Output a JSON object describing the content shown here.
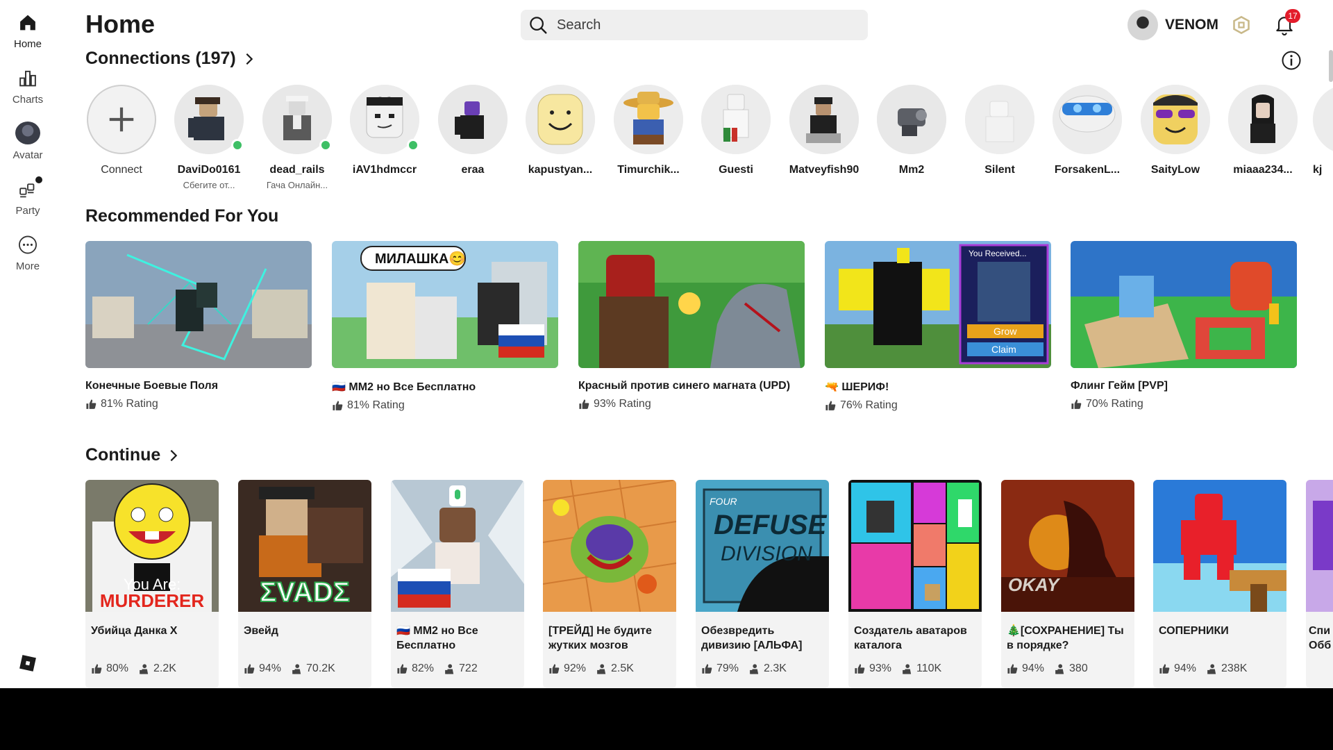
{
  "sidebar": {
    "items": [
      {
        "label": "Home",
        "icon": "home-icon"
      },
      {
        "label": "Charts",
        "icon": "charts-icon"
      },
      {
        "label": "Avatar",
        "icon": "avatar-icon"
      },
      {
        "label": "Party",
        "icon": "party-icon"
      },
      {
        "label": "More",
        "icon": "more-icon"
      }
    ]
  },
  "header": {
    "title": "Home",
    "search_placeholder": "Search",
    "username": "VENOM",
    "notification_count": "17"
  },
  "connections": {
    "title": "Connections (197)",
    "connect_label": "Connect",
    "friends": [
      {
        "name": "DaviDo0161",
        "status": "Сбегите от...",
        "online": true
      },
      {
        "name": "dead_rails",
        "status": "Гача Онлайн...",
        "online": true
      },
      {
        "name": "iAV1hdmccr",
        "status": "",
        "online": true
      },
      {
        "name": "eraa",
        "status": "",
        "online": false
      },
      {
        "name": "kapustyan...",
        "status": "",
        "online": false
      },
      {
        "name": "Timurchik...",
        "status": "",
        "online": false
      },
      {
        "name": "Guesti",
        "status": "",
        "online": false
      },
      {
        "name": "Matveyfish90",
        "status": "",
        "online": false
      },
      {
        "name": "Mm2",
        "status": "",
        "online": false
      },
      {
        "name": "Silent",
        "status": "",
        "online": false
      },
      {
        "name": "ForsakenL...",
        "status": "",
        "online": false
      },
      {
        "name": "SaityLow",
        "status": "",
        "online": false
      },
      {
        "name": "miaaa234...",
        "status": "",
        "online": false
      },
      {
        "name": "kj",
        "status": "",
        "online": false
      }
    ]
  },
  "recommended": {
    "title": "Recommended For You",
    "games": [
      {
        "title": "Конечные Боевые Поля",
        "rating": "81% Rating"
      },
      {
        "title": "🇷🇺 MM2 но Все Бесплатно",
        "rating": "81% Rating"
      },
      {
        "title": "Красный против синего магната (UPD)",
        "rating": "93% Rating"
      },
      {
        "title": "🔫 ШЕРИФ!",
        "rating": "76% Rating"
      },
      {
        "title": "Флинг Гейм [PVP]",
        "rating": "70% Rating"
      }
    ],
    "thumb_texts": {
      "milashka": "МИЛАШКА😊",
      "you_received": "You Received...",
      "grow": "Grow",
      "claim": "Claim"
    }
  },
  "continue": {
    "title": "Continue",
    "games": [
      {
        "title": "Убийца Данка X",
        "rating": "80%",
        "players": "2.2K"
      },
      {
        "title": "Эвейд",
        "rating": "94%",
        "players": "70.2K"
      },
      {
        "title": "🇷🇺 MM2 но Все Бесплатно",
        "rating": "82%",
        "players": "722"
      },
      {
        "title": "[ТРЕЙД] Не будите жутких мозгов",
        "rating": "92%",
        "players": "2.5K"
      },
      {
        "title": "Обезвредить дивизию [АЛЬФА]",
        "rating": "79%",
        "players": "2.3K"
      },
      {
        "title": "Создатель аватаров каталога",
        "rating": "93%",
        "players": "110K"
      },
      {
        "title": "🎄[СОХРАНЕНИЕ] Ты в порядке?",
        "rating": "94%",
        "players": "380"
      },
      {
        "title": "СОПЕРНИКИ",
        "rating": "94%",
        "players": "238K"
      },
      {
        "title": "Спи Обб",
        "rating": "",
        "players": ""
      }
    ],
    "thumb_texts": {
      "you_are": "You Are:",
      "murderer": "MURDERER",
      "evade": "ΣVADΣ",
      "four": "FOUR",
      "defuse": "DEFUSE",
      "division": "DIVISION",
      "okay": "OKAY"
    }
  }
}
